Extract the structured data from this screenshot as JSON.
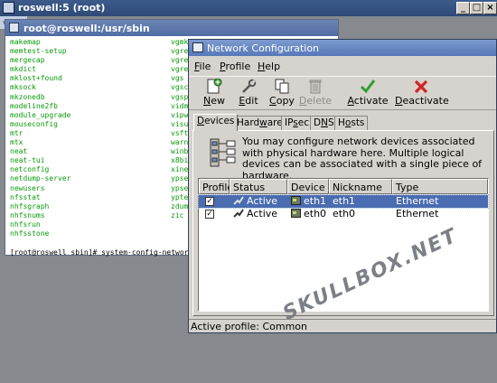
{
  "outer_window": {
    "title": "roswell:5 (root)",
    "tag": "vn"
  },
  "terminal": {
    "title": "root@roswell:/usr/sbin",
    "col1": [
      "makemap",
      "memtest-setup",
      "mergecap",
      "mkdict",
      "mklost+found",
      "mksock",
      "mkzonedb",
      "modeline2fb",
      "module_upgrade",
      "mouseconfig",
      "mtr",
      "mtx",
      "neat",
      "neat-tui",
      "netconfig",
      "netdump-server",
      "newusers",
      "nfsstat",
      "nhfsgraph",
      "nhfsnums",
      "nhfsrun",
      "nhfsstone"
    ],
    "col2": [
      "vgmk",
      "vgre",
      "vgre",
      "vgre",
      "vgs",
      "vgsca",
      "vgsp",
      "vidm",
      "vipw",
      "visu",
      "vsftp",
      "warn",
      "winb",
      "x8bi",
      "xinet",
      "ypse",
      "ypset",
      "yptes",
      "zdum",
      "zic"
    ],
    "prompt": "[root@roswell sbin]# system-config-network"
  },
  "network_config": {
    "title": "Network Configuration",
    "menu": [
      {
        "pre": "",
        "ul": "F",
        "post": "ile"
      },
      {
        "pre": "",
        "ul": "P",
        "post": "rofile"
      },
      {
        "pre": "",
        "ul": "H",
        "post": "elp"
      }
    ],
    "toolbar": [
      {
        "icon": "new-icon",
        "pre": "",
        "ul": "N",
        "post": "ew",
        "disabled": false
      },
      {
        "icon": "edit-icon",
        "pre": "",
        "ul": "E",
        "post": "dit",
        "disabled": false
      },
      {
        "icon": "copy-icon",
        "pre": "",
        "ul": "C",
        "post": "opy",
        "disabled": false
      },
      {
        "icon": "delete-icon",
        "pre": "",
        "ul": "D",
        "post": "elete",
        "disabled": true
      },
      {
        "icon": "activate-icon",
        "pre": "",
        "ul": "A",
        "post": "ctivate",
        "disabled": false
      },
      {
        "icon": "deactivate-icon",
        "pre": "",
        "ul": "D",
        "post": "eactivate",
        "disabled": false
      }
    ],
    "tabs": [
      {
        "pre": "",
        "ul": "D",
        "post": "evices",
        "active": true
      },
      {
        "pre": "Hard",
        "ul": "w",
        "post": "are",
        "active": false
      },
      {
        "pre": "IP",
        "ul": "s",
        "post": "ec",
        "active": false
      },
      {
        "pre": "D",
        "ul": "N",
        "post": "S",
        "active": false
      },
      {
        "pre": "H",
        "ul": "o",
        "post": "sts",
        "active": false
      }
    ],
    "info_text": "You may configure network devices associated with physical hardware here.  Multiple logical devices can be associated with a single piece of hardware.",
    "columns": [
      "Profile",
      "Status",
      "Device",
      "Nickname",
      "Type"
    ],
    "rows": [
      {
        "profile": "✓",
        "status": "Active",
        "device": "eth1",
        "nickname": "eth1",
        "type": "Ethernet",
        "selected": true
      },
      {
        "profile": "✓",
        "status": "Active",
        "device": "eth0",
        "nickname": "eth0",
        "type": "Ethernet",
        "selected": false
      }
    ],
    "statusbar": "Active profile: Common"
  },
  "watermark": "SKULLBOX.NET",
  "colors": {
    "terminal_text": "#0b9a0b",
    "selection": "#4a6cb0",
    "title_blue": "#5678b8"
  }
}
